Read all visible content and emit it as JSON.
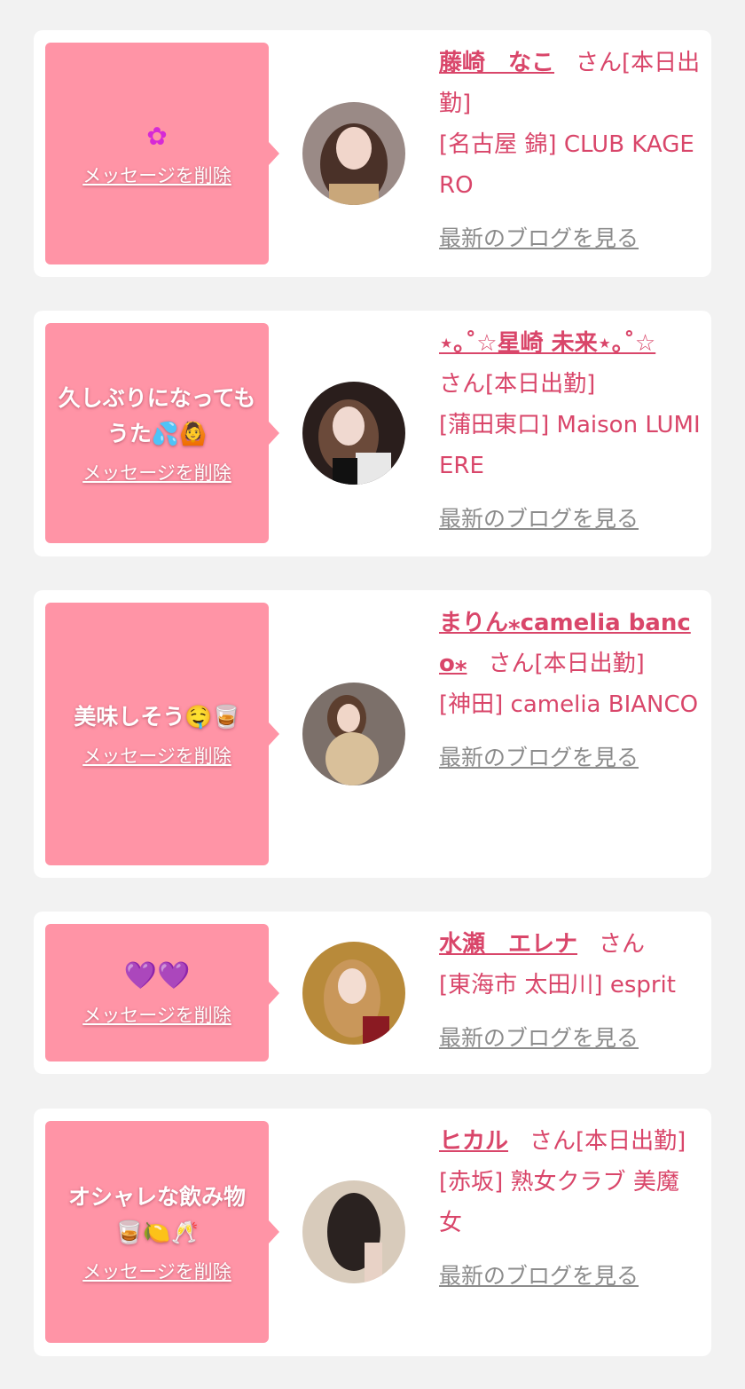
{
  "colors": {
    "page_bg": "#f2f2f2",
    "card_bg": "#ffffff",
    "bubble_bg": "#ff94a6",
    "name_color": "#d9466a",
    "blog_link_color": "#8c8c8c"
  },
  "entries": [
    {
      "message": "✿",
      "delete_label": "メッセージを削除",
      "cast_name": "藤崎　なこ",
      "suffix": "さん[本日出勤]",
      "shop": "[名古屋 錦] CLUB KAGERO",
      "blog_label": "最新のブログを見る"
    },
    {
      "message": "久しぶりになってもうた💦🙆",
      "delete_label": "メッセージを削除",
      "cast_name": "⋆｡˚☆星崎 未来⋆｡˚☆",
      "suffix": "さん[本日出勤]",
      "shop": "[蒲田東口] Maison LUMIERE",
      "blog_label": "最新のブログを見る"
    },
    {
      "message": "美味しそう🤤🥃",
      "delete_label": "メッセージを削除",
      "cast_name": "まりん⁎camelia banco⁎",
      "suffix": "さん[本日出勤]",
      "shop": "[神田] camelia BIANCO",
      "blog_label": "最新のブログを見る"
    },
    {
      "message": "💜💜",
      "delete_label": "メッセージを削除",
      "cast_name": "水瀬　エレナ",
      "suffix": "さん",
      "shop": "[東海市 太田川] esprit",
      "blog_label": "最新のブログを見る"
    },
    {
      "message": "オシャレな飲み物🥃🍋🥂",
      "delete_label": "メッセージを削除",
      "cast_name": "ヒカル",
      "suffix": "さん[本日出勤]",
      "shop": "[赤坂] 熟女クラブ 美魔女",
      "blog_label": "最新のブログを見る"
    }
  ]
}
